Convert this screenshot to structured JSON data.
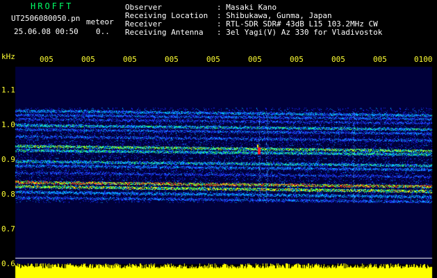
{
  "header": {
    "app_title": "HROFFT",
    "filename": "UT2506080050.pn",
    "tag": "meteor",
    "datetime": "25.06.08 00:50",
    "extra": "0..",
    "fields": [
      {
        "label": "Observer",
        "value": ": Masaki Kano"
      },
      {
        "label": "Receiving Location",
        "value": ": Shibukawa, Gunma, Japan"
      },
      {
        "label": "Receiver",
        "value": ": RTL-SDR SDR# 43dB L15 103.2MHz CW"
      },
      {
        "label": "Receiving Antenna",
        "value": ": 3el Yagi(V) Az 330 for Vladivostok"
      }
    ]
  },
  "time_axis": {
    "labels": [
      "005",
      "005",
      "005",
      "005",
      "005",
      "005",
      "005",
      "005",
      "005",
      "0100"
    ]
  },
  "freq_axis": {
    "unit": "kHz",
    "labels": [
      "1.1",
      "1.0",
      "0.9",
      "0.8",
      "0.7",
      "0.6"
    ]
  },
  "colors": {
    "text": "#ffffff",
    "title": "#00ff66",
    "axis_label": "#ffff33",
    "background": "#000000",
    "spectrum_bg": "#00003a",
    "band": "#ffff00"
  }
}
